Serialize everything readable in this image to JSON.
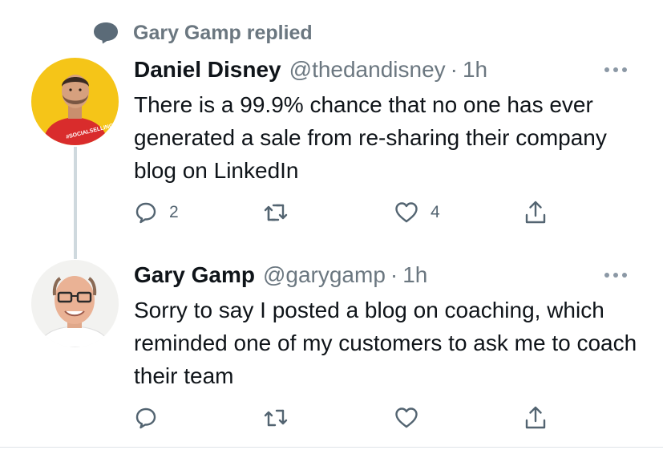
{
  "context": {
    "icon": "speech-bubble-icon",
    "text": "Gary Gamp replied"
  },
  "tweets": [
    {
      "name": "Daniel Disney",
      "handle": "@thedandisney",
      "separator": "·",
      "time": "1h",
      "avatar_badge": "#SOCIALSELLING",
      "text": "There is a 99.9% chance that no one has ever generated a sale from re-sharing their company blog on LinkedIn",
      "reply_count": "2",
      "retweet_count": "",
      "like_count": "4"
    },
    {
      "name": "Gary Gamp",
      "handle": "@garygamp",
      "separator": "·",
      "time": "1h",
      "text": "Sorry to say I posted a blog on coaching, which reminded one of my customers to ask me to coach their team",
      "reply_count": "",
      "retweet_count": "",
      "like_count": ""
    }
  ],
  "colors": {
    "primary_text": "#0f1419",
    "secondary_text": "#6b7780",
    "icon_gray": "#536471",
    "thread_line": "#cfd9de",
    "avatar_yellow": "#f5c518",
    "shirt_red": "#d92c2c"
  }
}
